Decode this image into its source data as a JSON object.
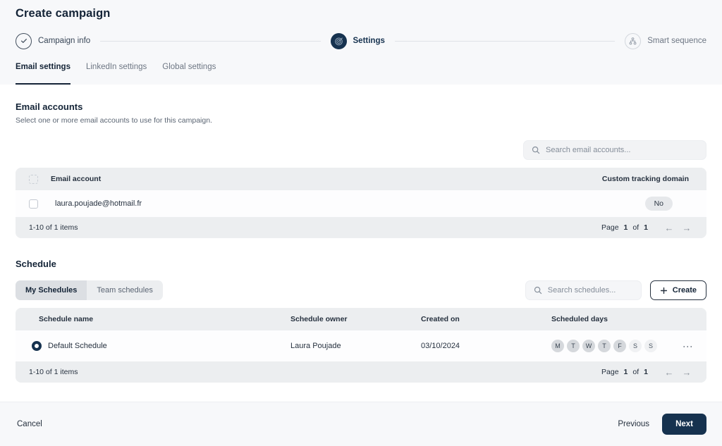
{
  "header": {
    "title": "Create campaign",
    "steps": [
      {
        "label": "Campaign info",
        "state": "done",
        "icon": "check-circle-icon"
      },
      {
        "label": "Settings",
        "state": "active",
        "icon": "target-icon"
      },
      {
        "label": "Smart sequence",
        "state": "todo",
        "icon": "hierarchy-icon"
      }
    ],
    "tabs": [
      {
        "label": "Email settings",
        "active": true
      },
      {
        "label": "LinkedIn settings",
        "active": false
      },
      {
        "label": "Global settings",
        "active": false
      }
    ]
  },
  "email_accounts": {
    "title": "Email accounts",
    "subtitle": "Select one or more email accounts to use for this campaign.",
    "search_placeholder": "Search email accounts...",
    "search_value": "",
    "columns": [
      "Email account",
      "Custom tracking domain"
    ],
    "rows": [
      {
        "email": "laura.poujade@hotmail.fr",
        "custom_tracking_domain": "No",
        "selected": false
      }
    ],
    "footer": {
      "items_range": "1-10 of 1 items",
      "page_label": "Page",
      "page_number": "1",
      "of_label": "of",
      "page_total": "1",
      "prev_icon": "arrow-left-icon",
      "next_icon": "arrow-right-icon"
    }
  },
  "schedule": {
    "title": "Schedule",
    "segments": [
      {
        "label": "My Schedules",
        "active": true
      },
      {
        "label": "Team schedules",
        "active": false
      }
    ],
    "search_placeholder": "Search schedules...",
    "search_value": "",
    "create_label": "Create",
    "create_icon": "plus-icon",
    "columns": [
      "Schedule name",
      "Schedule owner",
      "Created on",
      "Scheduled days"
    ],
    "rows": [
      {
        "name": "Default Schedule",
        "owner": "Laura Poujade",
        "created_on": "03/10/2024",
        "selected": true,
        "days": [
          {
            "letter": "M",
            "on": true
          },
          {
            "letter": "T",
            "on": true
          },
          {
            "letter": "W",
            "on": true
          },
          {
            "letter": "T",
            "on": true
          },
          {
            "letter": "F",
            "on": true
          },
          {
            "letter": "S",
            "on": false
          },
          {
            "letter": "S",
            "on": false
          }
        ],
        "menu_icon": "kebab-menu-icon"
      }
    ],
    "footer": {
      "items_range": "1-10 of 1 items",
      "page_label": "Page",
      "page_number": "1",
      "of_label": "of",
      "page_total": "1",
      "prev_icon": "arrow-left-icon",
      "next_icon": "arrow-right-icon"
    }
  },
  "footer": {
    "cancel_label": "Cancel",
    "previous_label": "Previous",
    "next_label": "Next"
  },
  "colors": {
    "primary": "#16324f",
    "header_bg": "#f7f8fa",
    "table_header_bg": "#eceef0",
    "text": "#142437",
    "muted": "#6d7683"
  }
}
